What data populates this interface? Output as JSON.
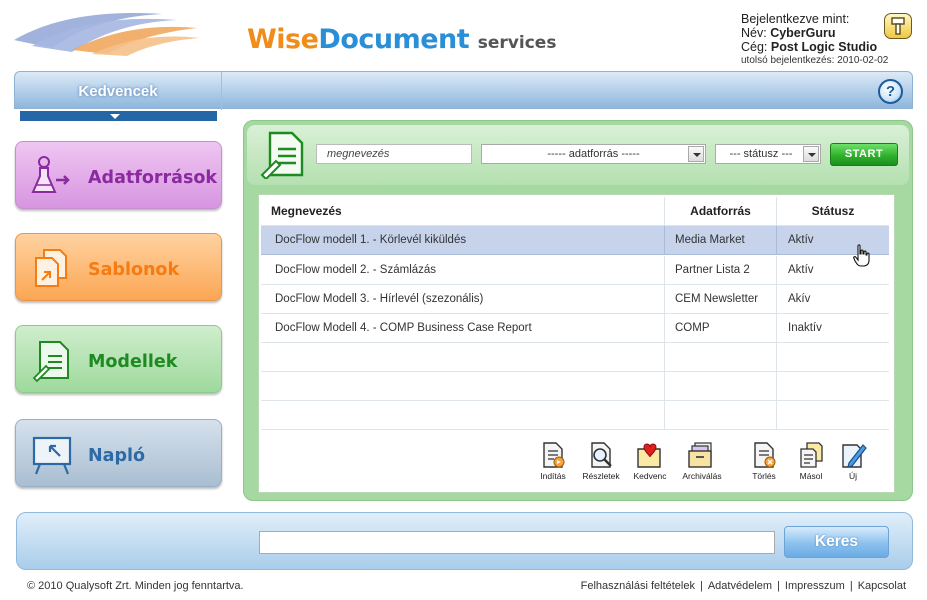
{
  "brand": {
    "word1": "Wise",
    "word2": "Document",
    "word3": "services"
  },
  "user": {
    "logged_in_as": "Bejelentkezve mint:",
    "name_label": "Név:",
    "name": "CyberGuru",
    "company_label": "Cég:",
    "company": "Post Logic Studio",
    "last_login": "utolsó bejelentkezés: 2010-02-02"
  },
  "nav": {
    "active_tab": "Kedvencek",
    "help": "?"
  },
  "sidebar": [
    {
      "label": "Adatforrások",
      "icon": "flask-person-icon",
      "color": "#8a2aa0"
    },
    {
      "label": "Sablonok",
      "icon": "documents-icon",
      "color": "#f47c12"
    },
    {
      "label": "Modellek",
      "icon": "document-edit-icon",
      "color": "#1f8a22"
    },
    {
      "label": "Napló",
      "icon": "presentation-board-icon",
      "color": "#2d6aa5"
    }
  ],
  "filter": {
    "name_value": "megnevezés",
    "source_value": "----- adatforrás -----",
    "status_value": "--- státusz ---",
    "start_label": "START"
  },
  "table": {
    "headers": [
      "Megnevezés",
      "Adatforrás",
      "Státusz"
    ],
    "rows": [
      [
        "DocFlow modell 1. - Körlevél kiküldés",
        "Media Market",
        "Aktív"
      ],
      [
        "DocFlow modell 2. - Számlázás",
        "Partner Lista 2",
        "Aktív"
      ],
      [
        "DocFlow Modell 3. - Hírlevél (szezonális)",
        "CEM Newsletter",
        "Akív"
      ],
      [
        "DocFlow Modell 4. - COMP Business Case Report",
        "COMP",
        "Inaktív"
      ]
    ],
    "empty_rows": 3
  },
  "actions": [
    {
      "label": "Indítás",
      "icon": "start-doc-icon"
    },
    {
      "label": "Részletek",
      "icon": "magnifier-doc-icon"
    },
    {
      "label": "Kedvenc",
      "icon": "heart-folder-icon"
    },
    {
      "label": "Archiválás",
      "icon": "archive-icon"
    },
    {
      "label": "Törlés",
      "icon": "delete-doc-icon"
    },
    {
      "label": "Másol",
      "icon": "copy-doc-icon"
    },
    {
      "label": "Új",
      "icon": "new-doc-pencil-icon"
    }
  ],
  "search": {
    "value": "",
    "button_label": "Keres"
  },
  "footer": {
    "copyright": "© 2010 Qualysoft Zrt. Minden jog fenntartva.",
    "links": [
      "Felhasználási feltételek",
      "Adatvédelem",
      "Impresszum",
      "Kapcsolat"
    ]
  },
  "colors": {
    "accent_blue": "#2a8fd6",
    "accent_orange": "#f08c1a",
    "panel_green": "#a6d8a2",
    "nav_dark": "#2566a6"
  }
}
